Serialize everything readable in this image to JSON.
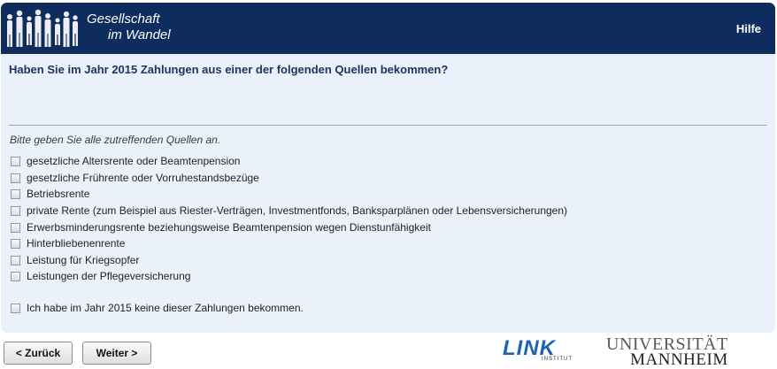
{
  "header": {
    "logo_line1": "Gesellschaft",
    "logo_line2": "im Wandel",
    "help_label": "Hilfe"
  },
  "question": "Haben Sie im Jahr 2015 Zahlungen aus einer der folgenden Quellen bekommen?",
  "instruction": "Bitte geben Sie alle zutreffenden Quellen an.",
  "options": [
    {
      "label": "gesetzliche Altersrente oder Beamtenpension",
      "checked": false
    },
    {
      "label": "gesetzliche Frührente oder Vorruhestandsbezüge",
      "checked": false
    },
    {
      "label": "Betriebsrente",
      "checked": false
    },
    {
      "label": "private Rente (zum Beispiel aus Riester-Verträgen, Investmentfonds, Banksparplänen oder Lebensversicherungen)",
      "checked": false
    },
    {
      "label": "Erwerbsminderungsrente beziehungsweise Beamtenpension wegen Dienstunfähigkeit",
      "checked": false
    },
    {
      "label": "Hinterbliebenenrente",
      "checked": false
    },
    {
      "label": "Leistung für Kriegsopfer",
      "checked": false
    },
    {
      "label": "Leistungen der Pflegeversicherung",
      "checked": false
    }
  ],
  "none_option": {
    "label": "Ich habe im Jahr 2015 keine dieser Zahlungen bekommen.",
    "checked": false
  },
  "nav": {
    "back_label": "< Zurück",
    "next_label": "Weiter >"
  },
  "footer": {
    "link_word": "LINK",
    "link_sub": "INSTITUT",
    "uni_line1": "UNIVERSITÄT",
    "uni_line2": "MANNHEIM"
  },
  "colors": {
    "header_bg": "#0e2c5d",
    "panel_bg": "#eaf1fa",
    "question_text": "#1a3560",
    "link_blue": "#1f64b2"
  }
}
